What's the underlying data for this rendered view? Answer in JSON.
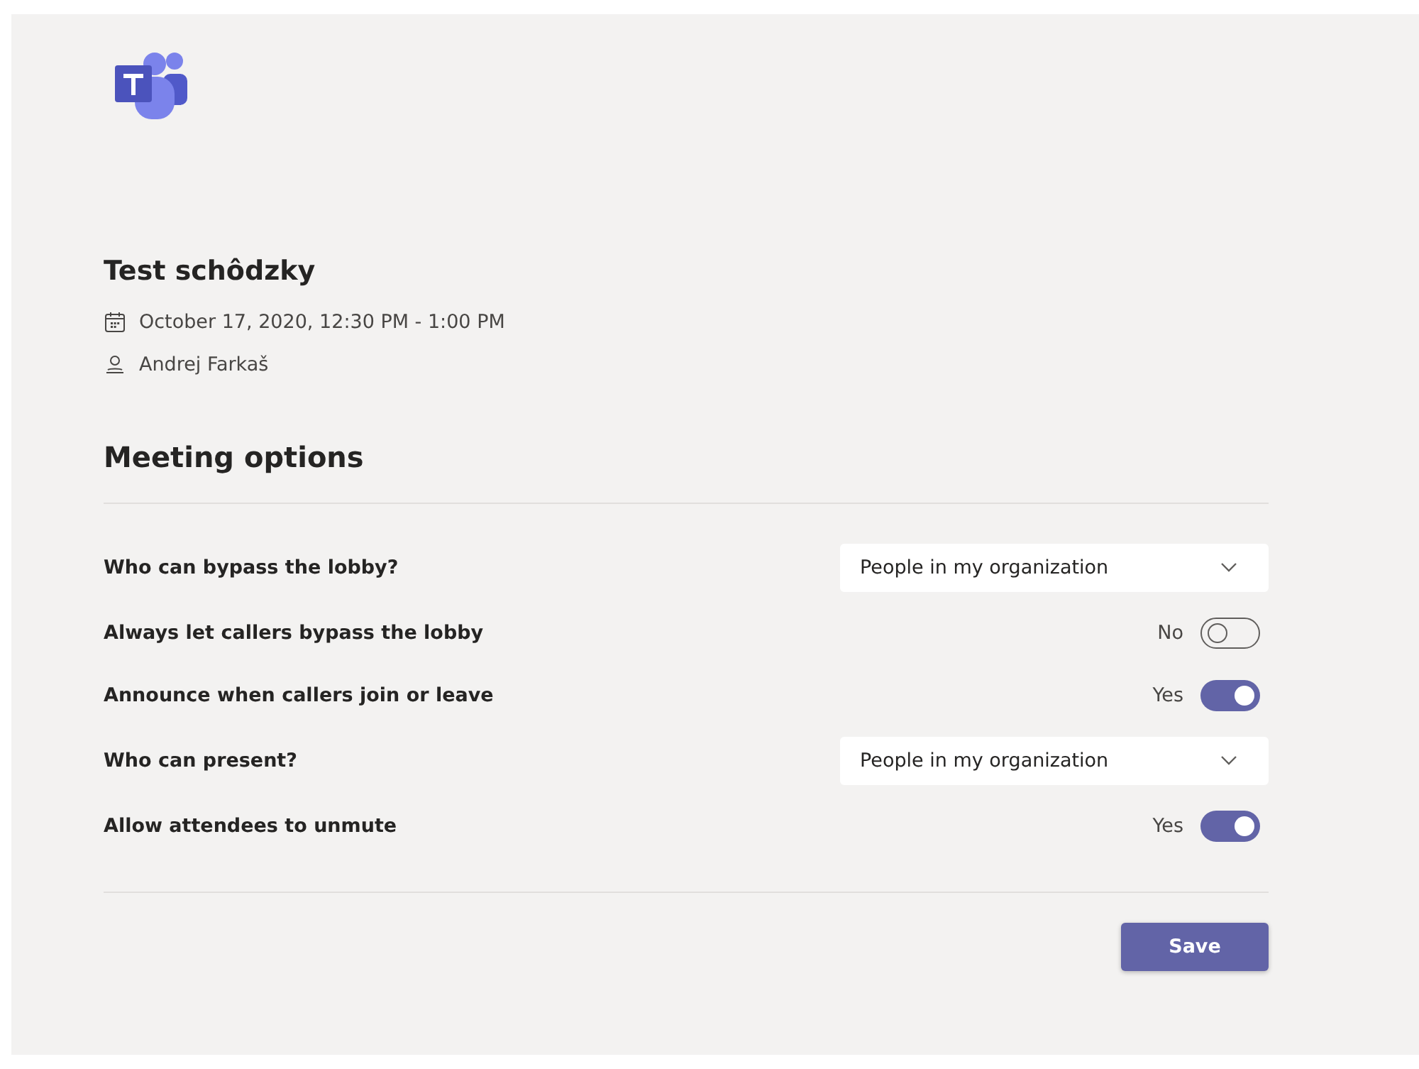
{
  "meeting": {
    "title": "Test schôdzky",
    "date": "October 17, 2020, 12:30 PM - 1:00 PM",
    "organizer": "Andrej Farkaš"
  },
  "section_title": "Meeting options",
  "options": [
    {
      "kind": "dropdown",
      "label": "Who can bypass the lobby?",
      "value": "People in my organization"
    },
    {
      "kind": "toggle",
      "label": "Always let callers bypass the lobby",
      "on": false,
      "state_text": "No"
    },
    {
      "kind": "toggle",
      "label": "Announce when callers join or leave",
      "on": true,
      "state_text": "Yes"
    },
    {
      "kind": "dropdown",
      "label": "Who can present?",
      "value": "People in my organization"
    },
    {
      "kind": "toggle",
      "label": "Allow attendees to unmute",
      "on": true,
      "state_text": "Yes"
    }
  ],
  "save_button": "Save"
}
